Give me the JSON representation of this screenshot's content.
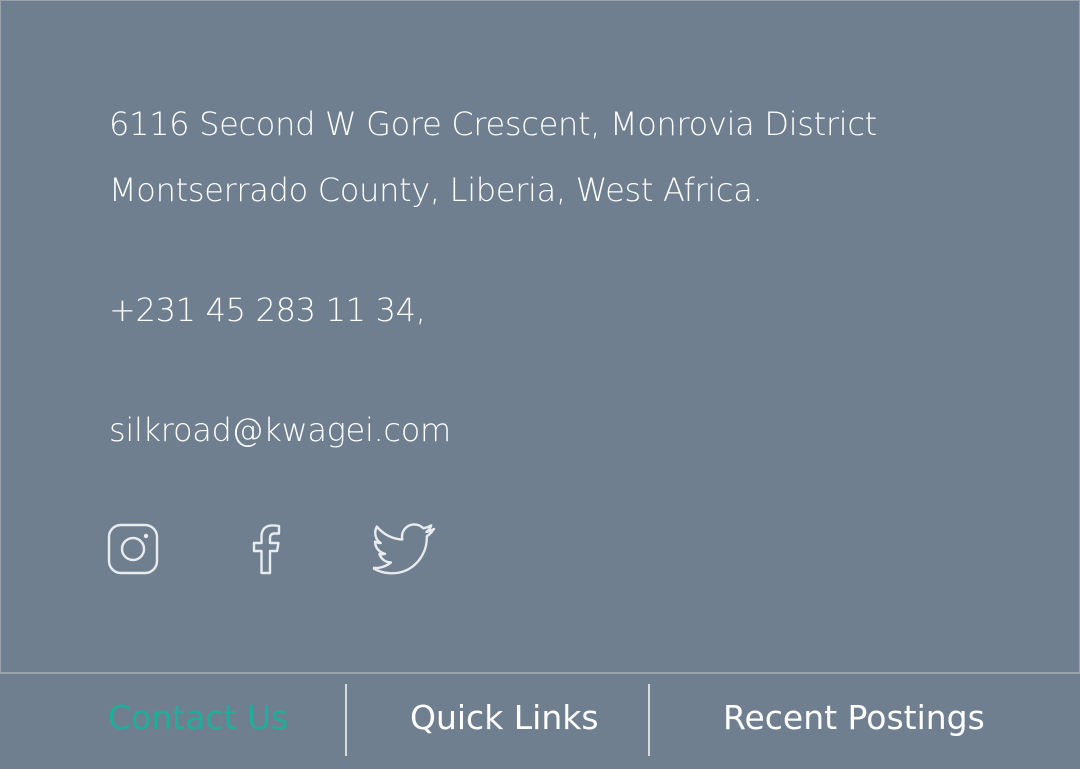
{
  "contact": {
    "address_line1": "6116 Second W Gore Crescent, Monrovia District",
    "address_line2": "Montserrado County, Liberia, West Africa.",
    "phone": "+231 45 283 11 34,",
    "email": "silkroad@kwagei.com"
  },
  "social": [
    {
      "icon": "instagram-icon"
    },
    {
      "icon": "facebook-icon"
    },
    {
      "icon": "twitter-icon"
    }
  ],
  "tabs": [
    {
      "label": "Contact Us",
      "active": true
    },
    {
      "label": "Quick Links",
      "active": false
    },
    {
      "label": "Recent Postings",
      "active": false
    }
  ],
  "colors": {
    "background": "#6f7f8f",
    "text": "#ffffff",
    "accent": "#1fae9a",
    "border": "#9aa2aa"
  }
}
